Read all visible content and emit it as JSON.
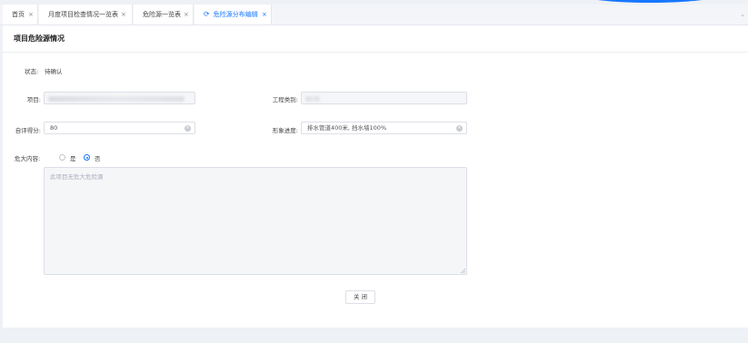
{
  "tabs": [
    {
      "label": "首页",
      "active": false
    },
    {
      "label": "月度项目检查情况一览表",
      "active": false
    },
    {
      "label": "危险源一览表",
      "active": false
    },
    {
      "label": "危险源分布编辑",
      "active": true
    }
  ],
  "tab_close_glyph": "×",
  "panel": {
    "title": "项目危险源情况"
  },
  "form": {
    "status_label": "状态:",
    "status_value": "待确认",
    "project_label": "项目:",
    "project_value": "",
    "category_label": "工程类别:",
    "category_value": "",
    "score_label": "自评得分:",
    "score_value": "80",
    "progress_label": "形象进度:",
    "progress_value": "排水管道400米, 挡水墙100%",
    "danger_label": "危大内容:",
    "radio_yes": "是",
    "radio_no": "否",
    "radio_selected": "否",
    "textarea_placeholder": "此项目无危大危险源",
    "close_button": "关 闭"
  },
  "colors": {
    "accent": "#1677ff",
    "border": "#dcdfe6",
    "disabled_bg": "#f5f6f8"
  }
}
